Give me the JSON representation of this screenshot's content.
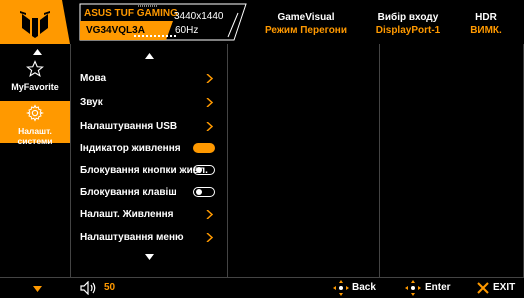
{
  "header": {
    "brand": "ASUS TUF GAMING",
    "model": "VG34VQL3A",
    "resolution": "3440x1440",
    "refresh": "60Hz",
    "gamevisual_label": "GameVisual",
    "gamevisual_value": "Режим Перегони",
    "input_label": "Вибір входу",
    "input_value": "DisplayPort-1",
    "hdr_label": "HDR",
    "hdr_value": "ВИМК."
  },
  "sidebar": {
    "items": [
      {
        "label": "MyFavorite",
        "icon": "star-icon"
      },
      {
        "label": "Налашт. системи",
        "icon": "gear-icon",
        "active": true
      }
    ]
  },
  "menu": {
    "items": [
      {
        "label": "Мова",
        "control": "chevron"
      },
      {
        "label": "Звук",
        "control": "chevron"
      },
      {
        "label": "Налаштування USB",
        "control": "chevron"
      },
      {
        "label": "Індикатор живлення",
        "control": "toggle-on"
      },
      {
        "label": "Блокування кнопки живл.",
        "control": "toggle-off"
      },
      {
        "label": "Блокування клавіш",
        "control": "toggle-off"
      },
      {
        "label": "Налашт. Живлення",
        "control": "chevron"
      },
      {
        "label": "Налаштування меню",
        "control": "chevron"
      }
    ]
  },
  "footer": {
    "volume_value": "50",
    "back_label": "Back",
    "enter_label": "Enter",
    "exit_label": "EXIT"
  },
  "colors": {
    "accent": "#ff9900",
    "background": "#000000",
    "exit_x": "#ff9900"
  }
}
